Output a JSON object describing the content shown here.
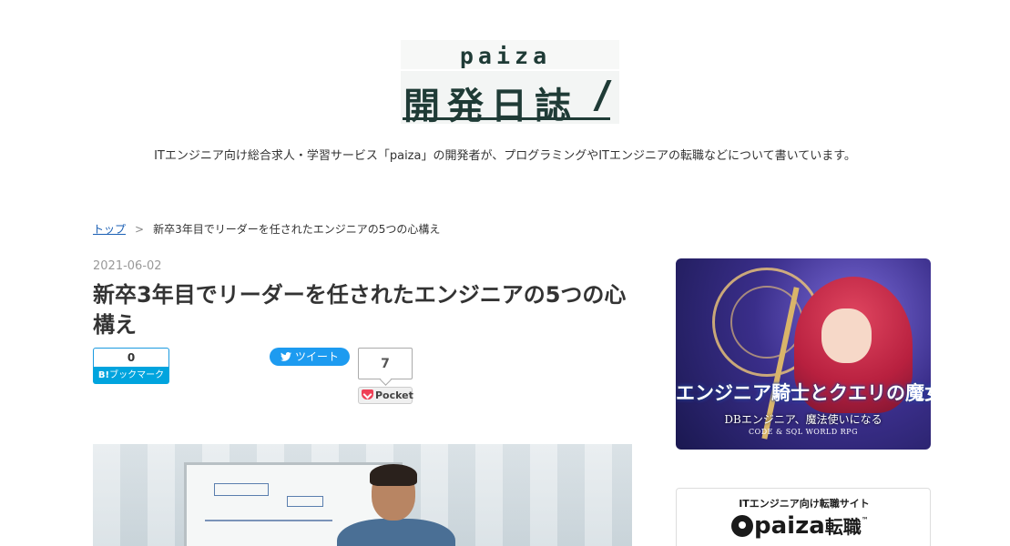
{
  "header": {
    "logo_paiza": "paiza",
    "logo_kanji": "開発日誌",
    "tagline": "ITエンジニア向け総合求人・学習サービス「paiza」の開発者が、プログラミングやITエンジニアの転職などについて書いています。"
  },
  "breadcrumb": {
    "home": "トップ",
    "separator": ">",
    "current": "新卒3年目でリーダーを任されたエンジニアの5つの心構え"
  },
  "article": {
    "date": "2021-06-02",
    "title": "新卒3年目でリーダーを任されたエンジニアの5つの心構え"
  },
  "share": {
    "hatena_count": "0",
    "hatena_b": "B!",
    "hatena_label": "ブックマーク",
    "tweet_label": "ツイート",
    "pocket_count": "7",
    "pocket_label": "Pocket"
  },
  "sidebar": {
    "ad_title": "エンジニア騎士とクエリの魔女",
    "ad_subtitle": "DBエンジニア、魔法使いになる",
    "ad_subtitle2": "CODE & SQL WORLD RPG",
    "paiza_label": "ITエンジニア向け転職サイト",
    "paiza_brand": "paiza",
    "paiza_tenshoku": "転職",
    "paiza_tm": "™"
  },
  "colors": {
    "logo": "#1f3b36",
    "link": "#1a5fb4",
    "hatena": "#00a4de",
    "twitter": "#1d9bf0",
    "pocket": "#ef4056"
  }
}
